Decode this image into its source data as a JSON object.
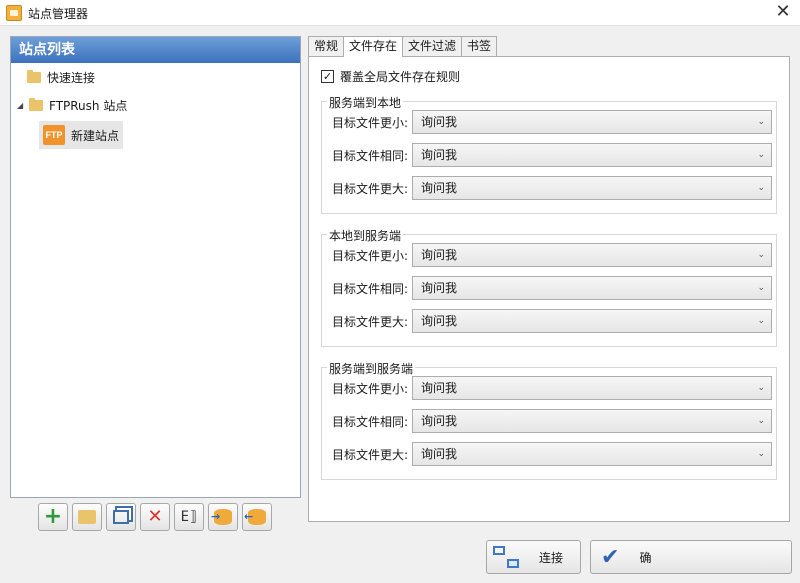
{
  "window": {
    "title": "站点管理器"
  },
  "left": {
    "header": "站点列表",
    "items": [
      {
        "label": "快速连接"
      },
      {
        "label": "FTPRush 站点"
      },
      {
        "label": "新建站点"
      }
    ],
    "ftp_badge": "FTP"
  },
  "toolbar": {
    "rename_glyph": "E⟧"
  },
  "tabs": [
    {
      "label": "常规"
    },
    {
      "label": "文件存在"
    },
    {
      "label": "文件过滤"
    },
    {
      "label": "书签"
    }
  ],
  "override": {
    "label": "覆盖全局文件存在规则",
    "checked": true
  },
  "groups": [
    {
      "title": "服务端到本地",
      "rows": [
        {
          "label": "目标文件更小:",
          "value": "询问我"
        },
        {
          "label": "目标文件相同:",
          "value": "询问我"
        },
        {
          "label": "目标文件更大:",
          "value": "询问我"
        }
      ]
    },
    {
      "title": "本地到服务端",
      "rows": [
        {
          "label": "目标文件更小:",
          "value": "询问我"
        },
        {
          "label": "目标文件相同:",
          "value": "询问我"
        },
        {
          "label": "目标文件更大:",
          "value": "询问我"
        }
      ]
    },
    {
      "title": "服务端到服务端",
      "rows": [
        {
          "label": "目标文件更小:",
          "value": "询问我"
        },
        {
          "label": "目标文件相同:",
          "value": "询问我"
        },
        {
          "label": "目标文件更大:",
          "value": "询问我"
        }
      ]
    }
  ],
  "buttons": {
    "connect": "连接",
    "ok": "确"
  },
  "colors": {
    "header_blue": "#3b72bd",
    "ftp_orange": "#f0932b",
    "add_green": "#2f9a3c",
    "delete_red": "#d8342a"
  }
}
